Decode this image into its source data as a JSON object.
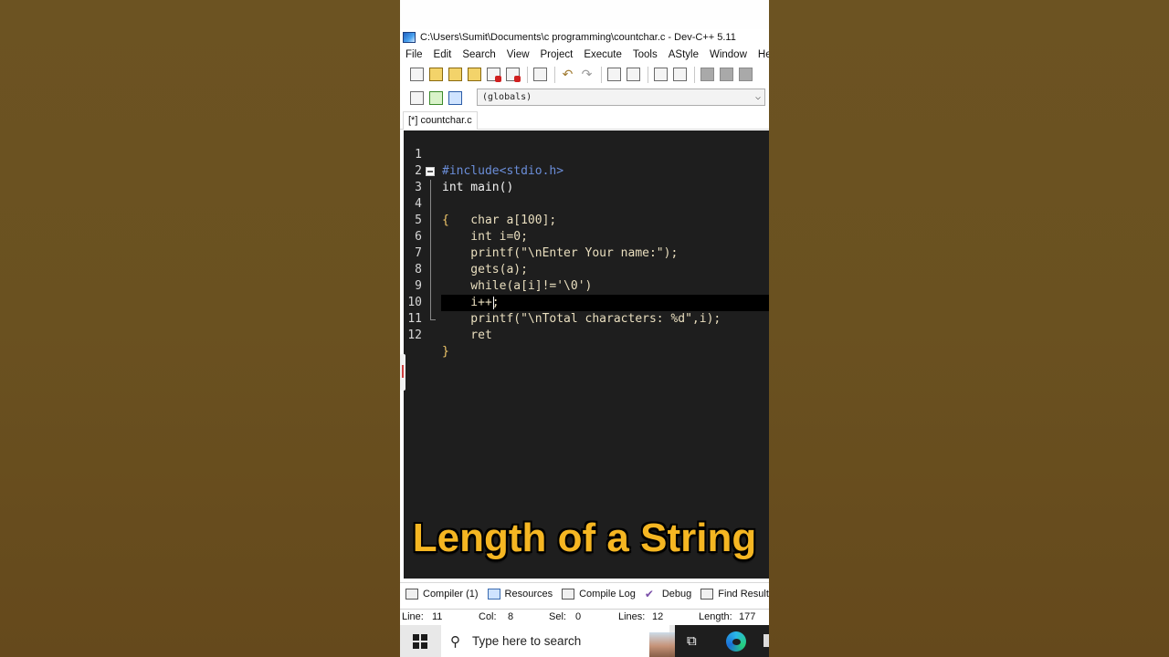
{
  "window": {
    "title": "C:\\Users\\Sumit\\Documents\\c programming\\countchar.c - Dev-C++ 5.11"
  },
  "menu": [
    "File",
    "Edit",
    "Search",
    "View",
    "Project",
    "Execute",
    "Tools",
    "AStyle",
    "Window",
    "Help"
  ],
  "scope_select": {
    "value": "(globals)"
  },
  "tab": {
    "label": "[*] countchar.c"
  },
  "code": {
    "current_line": 11,
    "lines": [
      {
        "n": "1",
        "text": "#include<stdio.h>"
      },
      {
        "n": "2",
        "text": "int main()"
      },
      {
        "n": "3",
        "text": "{"
      },
      {
        "n": "4",
        "text": "    char a[100];"
      },
      {
        "n": "5",
        "text": "    int i=0;"
      },
      {
        "n": "6",
        "text": "    printf(\"\\nEnter Your name:\");"
      },
      {
        "n": "7",
        "text": "    gets(a);"
      },
      {
        "n": "8",
        "text": "    while(a[i]!='\\0')"
      },
      {
        "n": "9",
        "text": "    i++;"
      },
      {
        "n": "10",
        "text": "    printf(\"\\nTotal characters: %d\",i);"
      },
      {
        "n": "11",
        "text": "    ret"
      },
      {
        "n": "12",
        "text": "}"
      }
    ]
  },
  "overlay_caption": "Length of a String",
  "bottom_tabs": [
    {
      "label": "Compiler (1)",
      "icon": "grid-icon"
    },
    {
      "label": "Resources",
      "icon": "resources-icon"
    },
    {
      "label": "Compile Log",
      "icon": "chart-icon"
    },
    {
      "label": "Debug",
      "icon": "check-icon"
    },
    {
      "label": "Find Results",
      "icon": "find-icon"
    }
  ],
  "status": {
    "line_label": "Line:",
    "line_value": "11",
    "col_label": "Col:",
    "col_value": "8",
    "sel_label": "Sel:",
    "sel_value": "0",
    "lines_label": "Lines:",
    "lines_value": "12",
    "length_label": "Length:",
    "length_value": "177"
  },
  "taskbar": {
    "search_placeholder": "Type here to search"
  },
  "colors": {
    "editor_bg": "#1e1e1e",
    "caption": "#f5b622",
    "background": "#6b5220"
  }
}
